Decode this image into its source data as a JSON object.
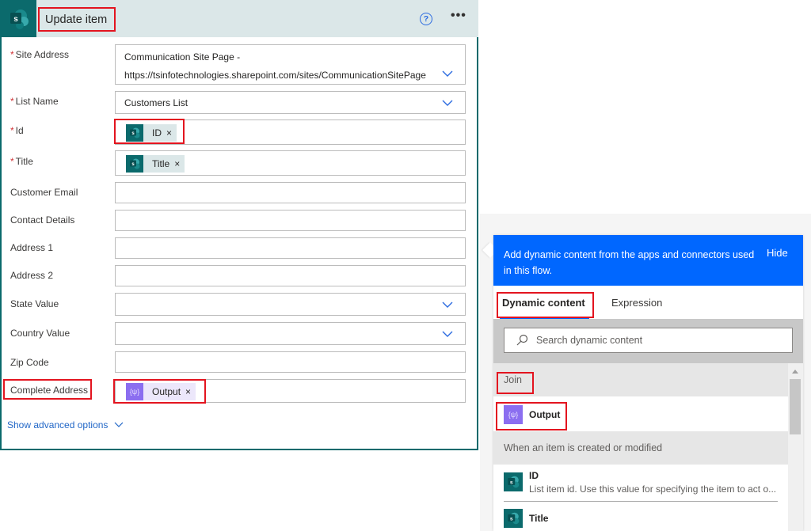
{
  "card": {
    "title": "Update item",
    "help_label": "?",
    "more_label": "•••",
    "connector_icon": "sharepoint-icon",
    "fields": [
      {
        "label": "Site Address",
        "required": true,
        "type": "dropdown",
        "value_line1": "Communication Site Page -",
        "value_line2": "https://tsinfotechnologies.sharepoint.com/sites/CommunicationSitePage"
      },
      {
        "label": "List Name",
        "required": true,
        "type": "dropdown",
        "value": "Customers List"
      },
      {
        "label": "Id",
        "required": true,
        "type": "token",
        "token": {
          "label": "ID",
          "icon": "sharepoint-icon"
        }
      },
      {
        "label": "Title",
        "required": true,
        "type": "token",
        "token": {
          "label": "Title",
          "icon": "sharepoint-icon"
        }
      },
      {
        "label": "Customer Email",
        "required": false,
        "type": "text",
        "value": ""
      },
      {
        "label": "Contact Details",
        "required": false,
        "type": "text",
        "value": ""
      },
      {
        "label": "Address 1",
        "required": false,
        "type": "text",
        "value": ""
      },
      {
        "label": "Address 2",
        "required": false,
        "type": "text",
        "value": ""
      },
      {
        "label": "State Value",
        "required": false,
        "type": "dropdown",
        "value": ""
      },
      {
        "label": "Country Value",
        "required": false,
        "type": "dropdown",
        "value": ""
      },
      {
        "label": "Zip Code",
        "required": false,
        "type": "text",
        "value": ""
      },
      {
        "label": "Complete Address",
        "required": false,
        "type": "token",
        "token": {
          "label": "Output",
          "icon": "variable-icon"
        }
      }
    ],
    "required_marker": "*",
    "token_remove": "×",
    "variable_glyph": "{ψ}",
    "sp_glyph": "s",
    "show_advanced": "Show advanced options"
  },
  "dynamic_panel": {
    "message": "Add dynamic content from the apps and connectors used in this flow.",
    "hide_label": "Hide",
    "tabs": [
      {
        "label": "Dynamic content",
        "active": true
      },
      {
        "label": "Expression",
        "active": false
      }
    ],
    "search_placeholder": "Search dynamic content",
    "groups": [
      {
        "title": "Join",
        "items": [
          {
            "name": "Output",
            "description": "",
            "icon": "variable-icon"
          }
        ]
      },
      {
        "title": "When an item is created or modified",
        "items": [
          {
            "name": "ID",
            "description": "List item id. Use this value for specifying the item to act o...",
            "icon": "sharepoint-icon"
          },
          {
            "name": "Title",
            "description": "",
            "icon": "sharepoint-icon"
          }
        ]
      }
    ]
  },
  "colors": {
    "accent_blue": "#0067ff",
    "sharepoint_teal": "#0b6a6c",
    "variable_purple": "#8b6ef0",
    "highlight_red": "#e3141f",
    "required_red": "#d13438"
  }
}
